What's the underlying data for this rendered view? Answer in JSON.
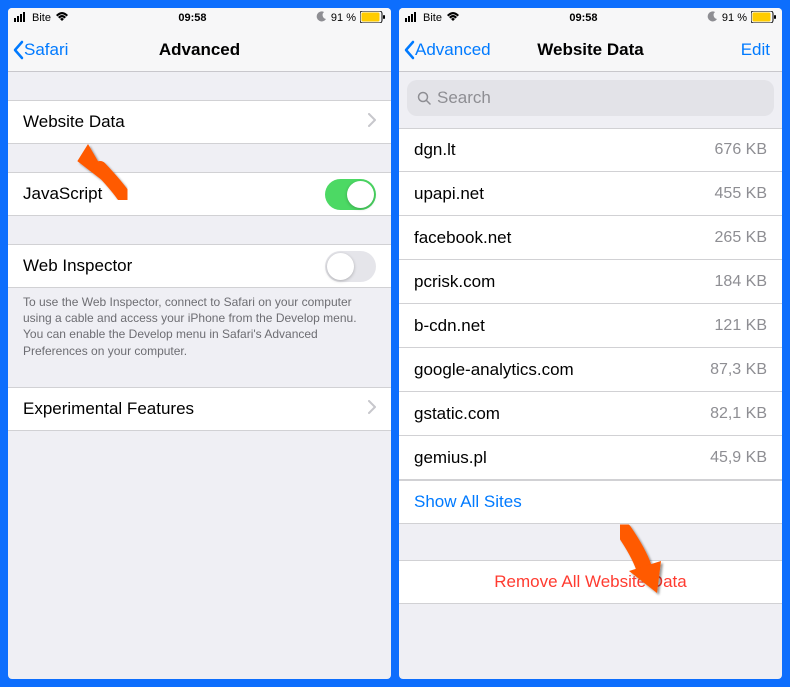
{
  "statusBar": {
    "carrier": "Bite",
    "time": "09:58",
    "battery": "91 %"
  },
  "left": {
    "back": "Safari",
    "title": "Advanced",
    "rows": {
      "websiteData": "Website Data",
      "javascript": "JavaScript",
      "webInspector": "Web Inspector",
      "experimental": "Experimental Features"
    },
    "footerText": "To use the Web Inspector, connect to Safari on your computer using a cable and access your iPhone from the Develop menu. You can enable the Develop menu in Safari's Advanced Preferences on your computer."
  },
  "right": {
    "back": "Advanced",
    "title": "Website Data",
    "edit": "Edit",
    "searchPlaceholder": "Search",
    "sites": [
      {
        "domain": "dgn.lt",
        "size": "676 KB"
      },
      {
        "domain": "upapi.net",
        "size": "455 KB"
      },
      {
        "domain": "facebook.net",
        "size": "265 KB"
      },
      {
        "domain": "pcrisk.com",
        "size": "184 KB"
      },
      {
        "domain": "b-cdn.net",
        "size": "121 KB"
      },
      {
        "domain": "google-analytics.com",
        "size": "87,3 KB"
      },
      {
        "domain": "gstatic.com",
        "size": "82,1 KB"
      },
      {
        "domain": "gemius.pl",
        "size": "45,9 KB"
      }
    ],
    "showAll": "Show All Sites",
    "removeAll": "Remove All Website Data"
  }
}
